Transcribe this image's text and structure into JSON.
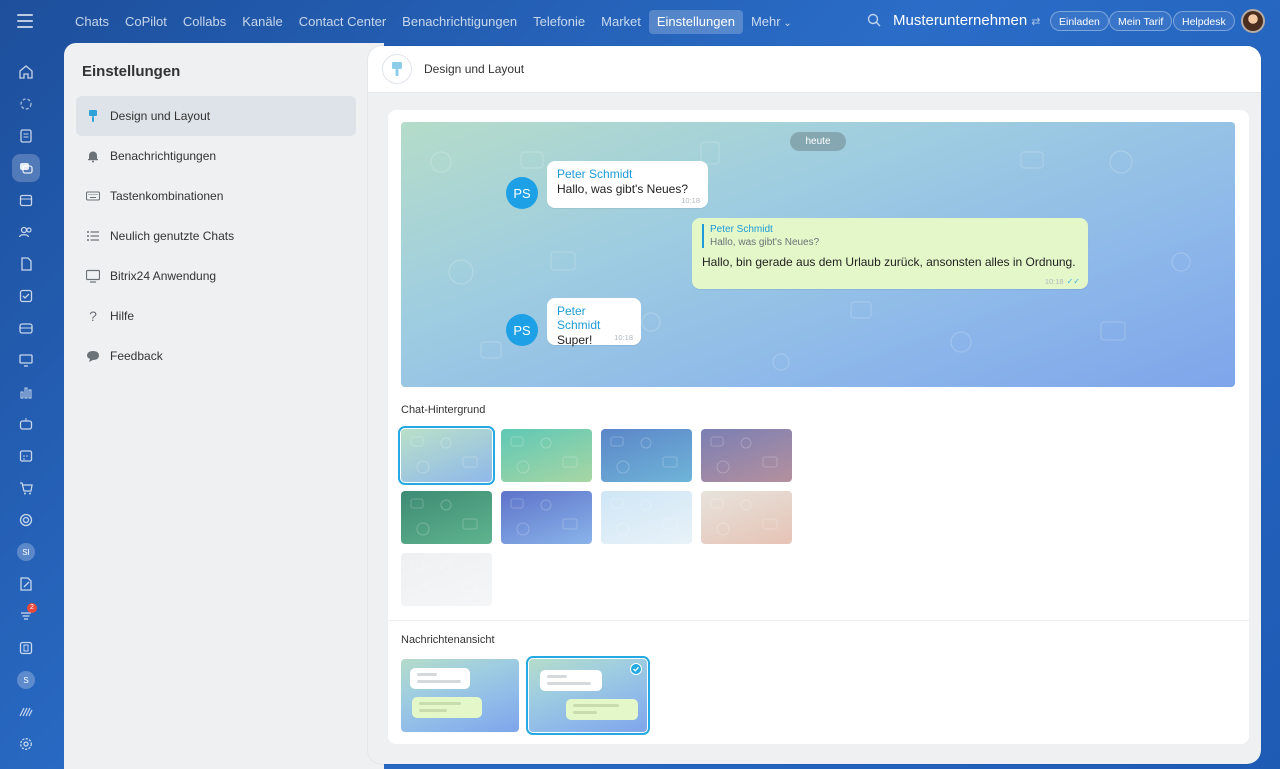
{
  "topbar": {
    "nav": [
      "Chats",
      "CoPilot",
      "Collabs",
      "Kanäle",
      "Contact Center",
      "Benachrichtigungen",
      "Telefonie",
      "Market",
      "Einstellungen",
      "Mehr"
    ],
    "active": "Einstellungen",
    "company": "Musterunternehmen",
    "buttons": {
      "invite": "Einladen",
      "tariff": "Mein Tarif",
      "helpdesk": "Helpdesk"
    }
  },
  "rail": {
    "icons": [
      "home-icon",
      "copilot-icon",
      "feed-icon",
      "chat-icon",
      "calendar-icon",
      "contacts-icon",
      "documents-icon",
      "tasks-icon",
      "crm-icon",
      "sites-icon",
      "analytics-icon",
      "robot-icon",
      "booking-icon",
      "shop-icon",
      "target-icon",
      "avatar-si",
      "signature-icon",
      "notifications-icon",
      "storage-icon",
      "avatar-s",
      "marketing-icon",
      "settings-icon"
    ],
    "avatar_si": "SI",
    "avatar_s": "S",
    "badge_count": "2"
  },
  "settings": {
    "title": "Einstellungen",
    "menu": [
      {
        "label": "Design und Layout",
        "icon": "brush-icon"
      },
      {
        "label": "Benachrichtigungen",
        "icon": "bell-icon"
      },
      {
        "label": "Tastenkombinationen",
        "icon": "keyboard-icon"
      },
      {
        "label": "Neulich genutzte Chats",
        "icon": "list-icon"
      },
      {
        "label": "Bitrix24 Anwendung",
        "icon": "monitor-icon"
      },
      {
        "label": "Hilfe",
        "icon": "help-icon"
      },
      {
        "label": "Feedback",
        "icon": "feedback-icon"
      }
    ],
    "active_index": 0
  },
  "panel": {
    "title": "Design und Layout",
    "preview": {
      "date": "heute",
      "messages": [
        {
          "author": "Peter Schmidt",
          "initials": "PS",
          "text": "Hallo, was gibt's Neues?",
          "time": "10:18"
        },
        {
          "quote_author": "Peter Schmidt",
          "quote_text": "Hallo, was gibt's Neues?",
          "text": "Hallo, bin gerade aus dem Urlaub zurück, ansonsten alles in Ordnung.",
          "time": "10:18"
        },
        {
          "author": "Peter Schmidt",
          "initials": "PS",
          "text": "Super!",
          "time": "10:18"
        }
      ]
    },
    "background_label": "Chat-Hintergrund",
    "backgrounds": [
      {
        "colors": [
          "#b9e0c8",
          "#8fb8ea"
        ]
      },
      {
        "colors": [
          "#5ec8b5",
          "#a8d6a4"
        ]
      },
      {
        "colors": [
          "#5b86c8",
          "#6fb4d8"
        ]
      },
      {
        "colors": [
          "#7a7fb4",
          "#b5909e"
        ]
      },
      {
        "colors": [
          "#3e8b74",
          "#5fb48e"
        ]
      },
      {
        "colors": [
          "#5e73c9",
          "#8ab4ea"
        ]
      },
      {
        "colors": [
          "#cfe6f6",
          "#e8f2f8"
        ]
      },
      {
        "colors": [
          "#e7e3dc",
          "#e6c3b5"
        ]
      },
      {
        "colors": [
          "#eef0f2",
          "#f5f6f7"
        ]
      }
    ],
    "selected_background": 0,
    "view_label": "Nachrichtenansicht",
    "selected_view": 1
  }
}
